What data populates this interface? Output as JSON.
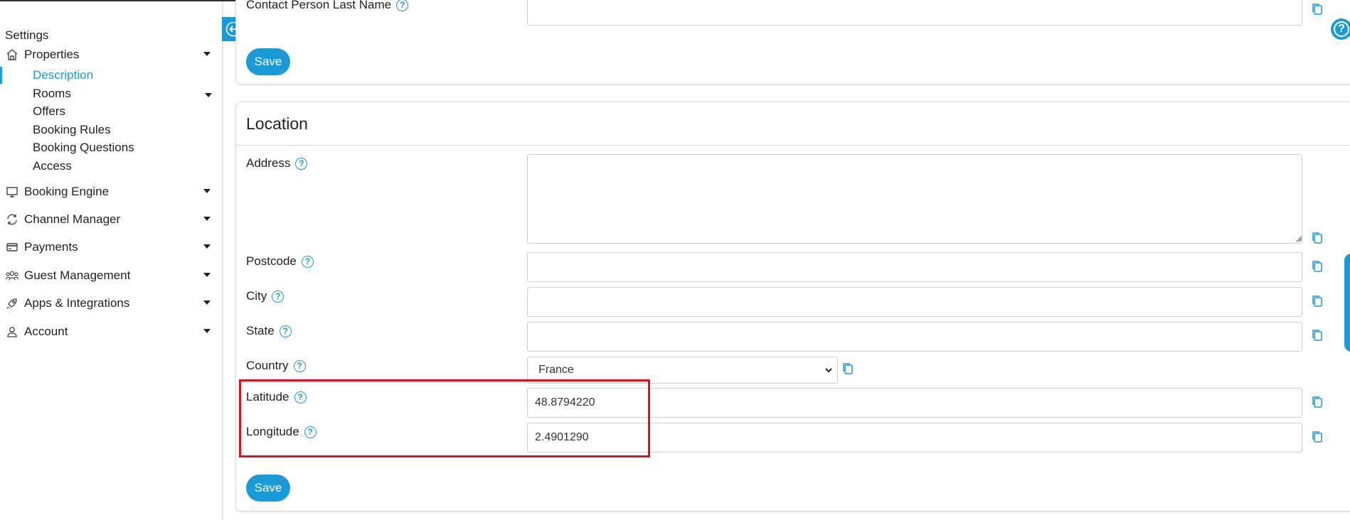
{
  "sidebar": {
    "title": "Settings",
    "items": [
      {
        "label": "Properties",
        "icon": "home-icon"
      },
      {
        "label": "Booking Engine",
        "icon": "monitor-icon"
      },
      {
        "label": "Channel Manager",
        "icon": "sync-icon"
      },
      {
        "label": "Payments",
        "icon": "credit-card-icon"
      },
      {
        "label": "Guest Management",
        "icon": "users-icon"
      },
      {
        "label": "Apps & Integrations",
        "icon": "rocket-icon"
      },
      {
        "label": "Account",
        "icon": "user-icon"
      }
    ],
    "sub_items": [
      {
        "label": "Description",
        "active": true
      },
      {
        "label": "Rooms"
      },
      {
        "label": "Offers"
      },
      {
        "label": "Booking Rules"
      },
      {
        "label": "Booking Questions"
      },
      {
        "label": "Access"
      }
    ]
  },
  "top_panel": {
    "field_label": "Contact Person Last Name",
    "save_label": "Save"
  },
  "location": {
    "title": "Location",
    "fields": {
      "address": {
        "label": "Address",
        "value": ""
      },
      "postcode": {
        "label": "Postcode",
        "value": ""
      },
      "city": {
        "label": "City",
        "value": ""
      },
      "state": {
        "label": "State",
        "value": ""
      },
      "country": {
        "label": "Country",
        "value": "France"
      },
      "latitude": {
        "label": "Latitude",
        "value": "48.8794220"
      },
      "longitude": {
        "label": "Longitude",
        "value": "2.4901290"
      }
    },
    "save_label": "Save"
  },
  "help_symbol": "?",
  "colors": {
    "accent": "#1a9ad6",
    "highlight": "#e0101d"
  }
}
